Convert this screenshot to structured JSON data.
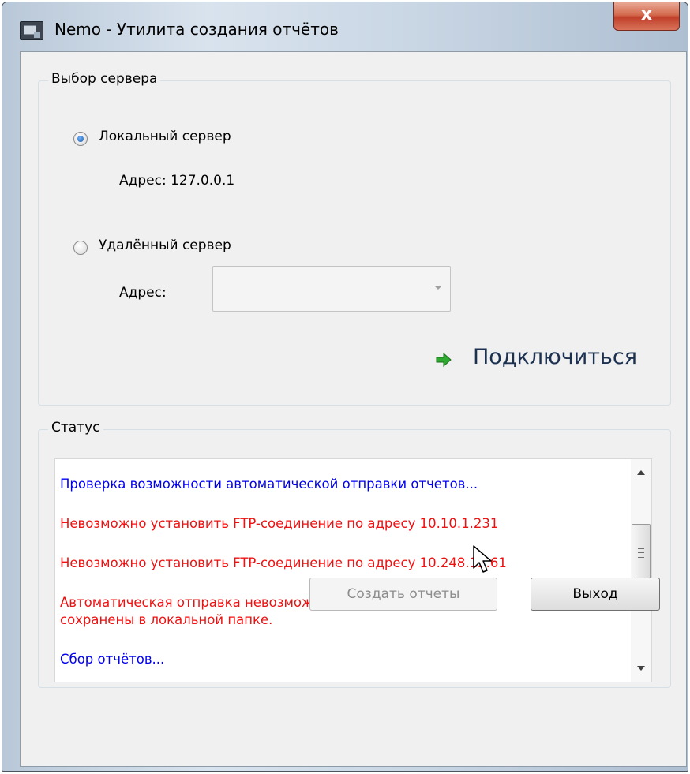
{
  "window": {
    "title": "Nemo - Утилита создания отчётов",
    "close_label": "x"
  },
  "server_group": {
    "title": "Выбор сервера",
    "local_label": "Локальный сервер",
    "local_address": "Адрес: 127.0.0.1",
    "remote_label": "Удалённый сервер",
    "address_label": "Адрес:",
    "address_value": "",
    "connect_label": "Подключиться",
    "selected": "local"
  },
  "status_group": {
    "title": "Статус",
    "log": [
      {
        "text": "Проверка возможности автоматической отправки отчетов...",
        "color": "#0000ee"
      },
      {
        "text": "Невозможно установить FTP-соединение по адресу 10.10.1.231",
        "color": "#ee1111"
      },
      {
        "text": "Невозможно установить FTP-соединение по адресу 10.248.12.61",
        "color": "#ee1111"
      },
      {
        "text": "Автоматическая отправка невозможна. Файлы отчётов будут",
        "color": "#ee1111"
      },
      {
        "text": "сохранены в локальной папке.",
        "color": "#ee1111"
      },
      {
        "text": "Сбор отчётов...",
        "color": "#0000ee"
      }
    ]
  },
  "buttons": {
    "create_label": "Создать отчеты",
    "create_enabled": false,
    "exit_label": "Выход"
  },
  "icons": {
    "app": "app-icon",
    "close": "close-icon",
    "connect": "green-arrow-icon",
    "cursor": "mouse-pointer-icon"
  }
}
